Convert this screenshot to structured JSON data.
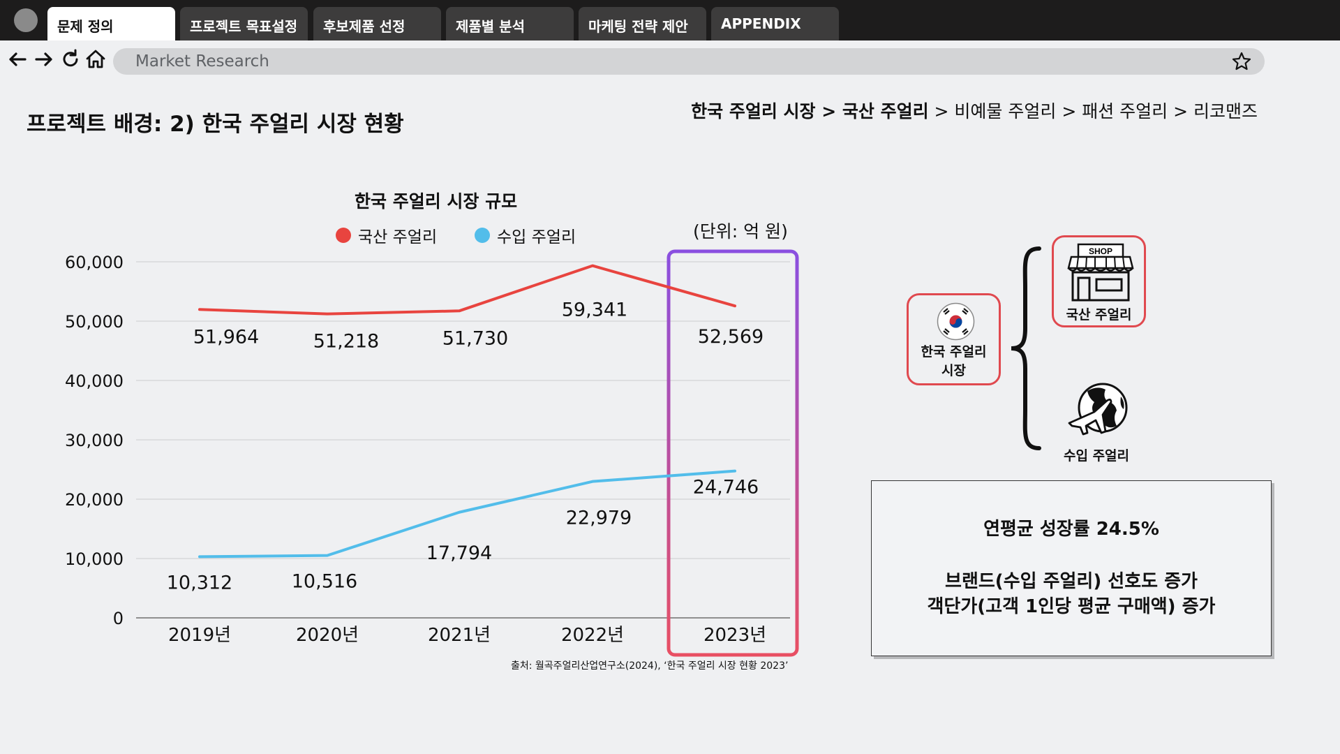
{
  "tabs": [
    {
      "label": "문제 정의",
      "active": true
    },
    {
      "label": "프로젝트 목표설정",
      "active": false
    },
    {
      "label": "후보제품 선정",
      "active": false
    },
    {
      "label": "제품별 분석",
      "active": false
    },
    {
      "label": "마케팅 전략 제안",
      "active": false
    },
    {
      "label": "APPENDIX",
      "active": false
    }
  ],
  "address_bar": {
    "text": "Market Research"
  },
  "page": {
    "title": "프로젝트 배경: 2) 한국 주얼리 시장 현황"
  },
  "breadcrumb": {
    "bold": "한국 주얼리 시장 > 국산 주얼리",
    "rest": " > 비예물 주얼리 > 패션 주얼리 > 리코맨즈"
  },
  "chart_data": {
    "type": "line",
    "title": "한국 주얼리 시장 규모",
    "unit": "(단위: 억 원)",
    "categories": [
      "2019년",
      "2020년",
      "2021년",
      "2022년",
      "2023년"
    ],
    "yticks": [
      "0",
      "10,000",
      "20,000",
      "30,000",
      "40,000",
      "50,000",
      "60,000"
    ],
    "ylim": [
      0,
      60000
    ],
    "grid": true,
    "legend_position": "top",
    "highlight_category": "2023년",
    "series": [
      {
        "name": "국산 주얼리",
        "color": "#e8443f",
        "values": [
          51964,
          51218,
          51730,
          59341,
          52569
        ],
        "labels": [
          "51,964",
          "51,218",
          "51,730",
          "59,341",
          "52,569"
        ]
      },
      {
        "name": "수입 주얼리",
        "color": "#52bdea",
        "values": [
          10312,
          10516,
          17794,
          22979,
          24746
        ],
        "labels": [
          "10,312",
          "10,516",
          "17,794",
          "22,979",
          "24,746"
        ]
      }
    ],
    "source": "출처: 월곡주얼리산업연구소(2024), ‘한국 주얼리 시장 현황 2023’"
  },
  "diagram": {
    "root_label_line1": "한국 주얼리",
    "root_label_line2": "시장",
    "domestic_label": "국산 주얼리",
    "shop_sign": "SHOP",
    "import_label": "수입 주얼리"
  },
  "info_box": {
    "growth": "연평균 성장률 24.5%",
    "line1": "브랜드(수입 주얼리) 선호도 증가",
    "line2": "객단가(고객 1인당 평균 구매액) 증가"
  },
  "colors": {
    "accent_red": "#e0494f",
    "highlight_purple": "#8a4fe0",
    "highlight_pink": "#e84f63"
  }
}
